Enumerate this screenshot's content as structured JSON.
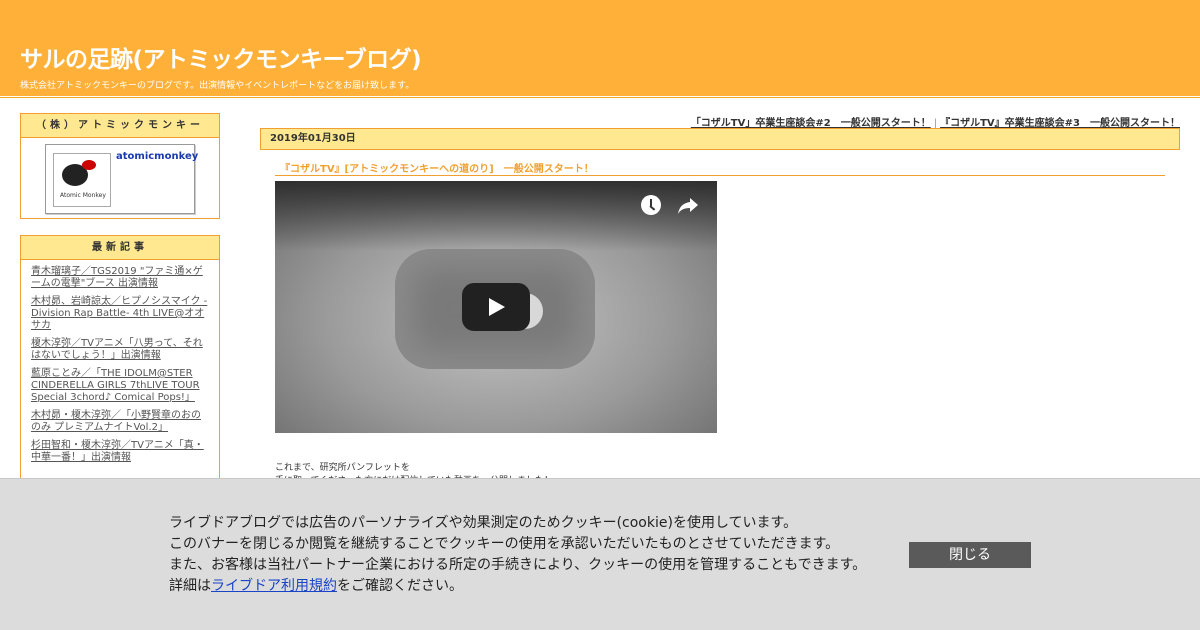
{
  "header": {
    "title": "サルの足跡(アトミックモンキーブログ)",
    "description": "株式会社アトミックモンキーのブログです。出演情報やイベントレポートなどをお届け致します。"
  },
  "sidebar": {
    "profile": {
      "heading": "（株）アトミックモンキー",
      "name": "atomicmonkey",
      "logo_text": "Atomic Monkey"
    },
    "recent": {
      "heading": "最新記事",
      "items": [
        "青木瑠璃子／TGS2019 \"ファミ通×ゲームの電撃\"ブース 出演情報",
        "木村昴、岩崎諒太／ヒプノシスマイク -Division Rap Battle- 4th LIVE@オオサカ",
        "榎木淳弥／TVアニメ「八男って、それはないでしょう！」出演情報",
        "藍原ことみ／「THE IDOLM@STER CINDERELLA GIRLS 7thLIVE TOUR Special 3chord♪ Comical Pops!」",
        "木村昴・榎木淳弥／「小野賢章のおののみ プレミアムナイトVol.2」",
        "杉田智和・榎木淳弥／TVアニメ「真・中華一番！」出演情報"
      ]
    }
  },
  "main": {
    "nav": {
      "prev": "「コザルTV」卒業生座談会#2　一般公開スタート！",
      "separator": "|",
      "next": "『コザルTV』卒業生座談会#3　一般公開スタート！"
    },
    "date": "2019年01月30日",
    "post_title": "『コザルTV』[アトミックモンキーへの道のり]　一般公開スタート！",
    "video": {
      "play_icon": "play-icon",
      "watch_later_icon": "clock-icon",
      "share_icon": "share-icon"
    },
    "body_line1": "これまで、研究所パンフレットを",
    "body_line2": "手に取ってくださった方にだけ配信していた動画を一公開しました！"
  },
  "cookie_banner": {
    "line1": "ライブドアブログでは広告のパーソナライズや効果測定のためクッキー(cookie)を使用しています。",
    "line2": "このバナーを閉じるか閲覧を継続することでクッキーの使用を承認いただいたものとさせていただきます。",
    "line3": "また、お客様は当社パートナー企業における所定の手続きにより、クッキーの使用を管理することもできます。",
    "line4_prefix": "詳細は",
    "line4_link": "ライブドア利用規約",
    "line4_suffix": "をご確認ください。",
    "close_label": "閉じる"
  }
}
